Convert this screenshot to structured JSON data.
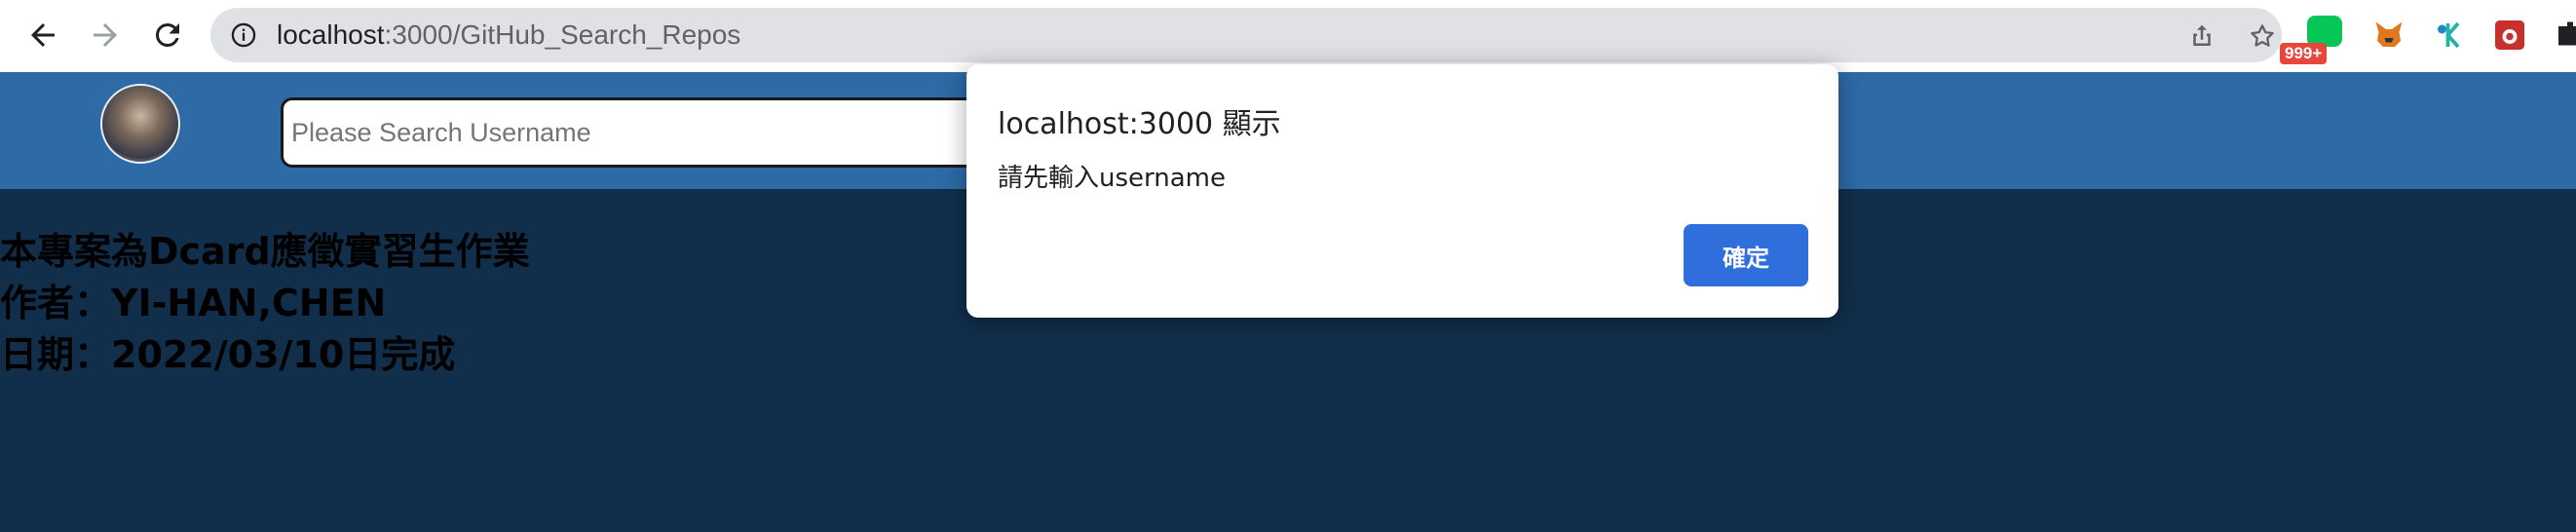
{
  "browser": {
    "url_host": "localhost",
    "url_path": ":3000/GitHub_Search_Repos",
    "extension_badge": "999+"
  },
  "app": {
    "search": {
      "placeholder": "Please Search Username",
      "value": ""
    },
    "content_lines": [
      "本專案為Dcard應徵實習生作業",
      "作者：YI-HAN,CHEN",
      "日期：2022/03/10日完成"
    ]
  },
  "dialog": {
    "title": "localhost:3000 顯示",
    "message": "請先輸入username",
    "ok_label": "確定"
  },
  "colors": {
    "header": "#2d6aa6",
    "page_background": "#112e4a",
    "dialog_button": "#2f6fdc"
  },
  "icons": [
    "back-arrow-icon",
    "forward-arrow-icon",
    "reload-icon",
    "info-icon",
    "share-icon",
    "star-icon",
    "line-extension-icon",
    "metamask-fox-icon",
    "extension-k-icon",
    "extension-bug-icon",
    "puzzle-icon"
  ]
}
